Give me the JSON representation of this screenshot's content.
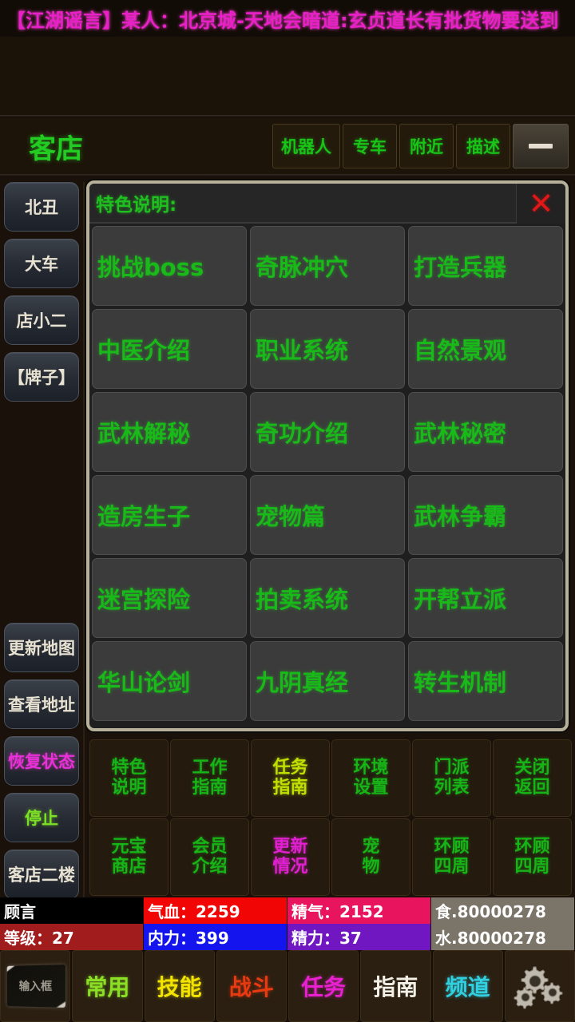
{
  "marquee": {
    "text": "【江湖谣言】某人：北京城-天地会暗道:玄贞道长有批货物要送到"
  },
  "header": {
    "title": "客店",
    "buttons": [
      {
        "label": "机器人",
        "name": "robot-button"
      },
      {
        "label": "专车",
        "name": "special-car-button"
      },
      {
        "label": "附近",
        "name": "nearby-button"
      },
      {
        "label": "描述",
        "name": "describe-button"
      }
    ],
    "minimize": {
      "icon": "minus-icon",
      "label": "—"
    }
  },
  "sidebar": {
    "top_items": [
      {
        "label": "北丑",
        "style": "default"
      },
      {
        "label": "大车",
        "style": "default"
      },
      {
        "label": "店小二",
        "style": "default"
      },
      {
        "label": "【牌子】",
        "style": "default"
      }
    ],
    "bottom_items": [
      {
        "label": "更新地图",
        "style": "default"
      },
      {
        "label": "查看地址",
        "style": "default"
      },
      {
        "label": "恢复状态",
        "style": "magenta"
      },
      {
        "label": "停止",
        "style": "green"
      },
      {
        "label": "客店二楼",
        "style": "default"
      }
    ]
  },
  "modal": {
    "title": "特色说明:",
    "close_icon": "close-icon",
    "close_label": "✕",
    "items": [
      "挑战boss",
      "奇脉冲穴",
      "打造兵器",
      "中医介绍",
      "职业系统",
      "自然景观",
      "武林解秘",
      "奇功介绍",
      "武林秘密",
      "造房生子",
      "宠物篇",
      "武林争霸",
      "迷宫探险",
      "拍卖系统",
      "开帮立派",
      "华山论剑",
      "九阴真经",
      "转生机制"
    ]
  },
  "actions": [
    {
      "line1": "特色",
      "line2": "说明",
      "style": "normal"
    },
    {
      "line1": "工作",
      "line2": "指南",
      "style": "normal"
    },
    {
      "line1": "任务",
      "line2": "指南",
      "style": "yellow"
    },
    {
      "line1": "环境",
      "line2": "设置",
      "style": "normal"
    },
    {
      "line1": "门派",
      "line2": "列表",
      "style": "normal"
    },
    {
      "line1": "关闭",
      "line2": "返回",
      "style": "normal"
    },
    {
      "line1": "元宝",
      "line2": "商店",
      "style": "normal"
    },
    {
      "line1": "会员",
      "line2": "介绍",
      "style": "normal"
    },
    {
      "line1": "更新",
      "line2": "情况",
      "style": "magenta"
    },
    {
      "line1": "宠",
      "line2": "物",
      "style": "normal"
    },
    {
      "line1": "环顾",
      "line2": "四周",
      "style": "normal"
    },
    {
      "line1": "环顾",
      "line2": "四周",
      "style": "normal"
    }
  ],
  "status": [
    {
      "label": "顾言",
      "bg": "#000000",
      "fg": "#ffffff"
    },
    {
      "label": "气血：2259",
      "bg": "#f20505",
      "fg": "#ffffff"
    },
    {
      "label": "精气：2152",
      "bg": "#e8155e",
      "fg": "#ffffff"
    },
    {
      "label": "食.80000278",
      "bg": "#7b7468",
      "fg": "#ffffff"
    },
    {
      "label": "等级：27",
      "bg": "#a11c1c",
      "fg": "#ffffff"
    },
    {
      "label": "内力：399",
      "bg": "#1414ee",
      "fg": "#ffffff"
    },
    {
      "label": "精力：37",
      "bg": "#7017c2",
      "fg": "#ffffff"
    },
    {
      "label": "水.80000278",
      "bg": "#7b7468",
      "fg": "#ffffff"
    }
  ],
  "bottom_nav": [
    {
      "label": "输入框",
      "style": "input",
      "name": "text-input-button"
    },
    {
      "label": "常用",
      "style": "c-green",
      "name": "nav-common"
    },
    {
      "label": "技能",
      "style": "c-yellow",
      "name": "nav-skills"
    },
    {
      "label": "战斗",
      "style": "c-red",
      "name": "nav-combat"
    },
    {
      "label": "任务",
      "style": "c-magenta",
      "name": "nav-quests"
    },
    {
      "label": "指南",
      "style": "c-white",
      "name": "nav-guide"
    },
    {
      "label": "频道",
      "style": "c-cyan",
      "name": "nav-channel"
    },
    {
      "label": "设置",
      "style": "gears",
      "name": "nav-settings"
    }
  ],
  "colors": {
    "background": "#19110a",
    "green_text": "#19b919",
    "magenta_text": "#e820c8",
    "modal_border": "#b7b09a"
  }
}
